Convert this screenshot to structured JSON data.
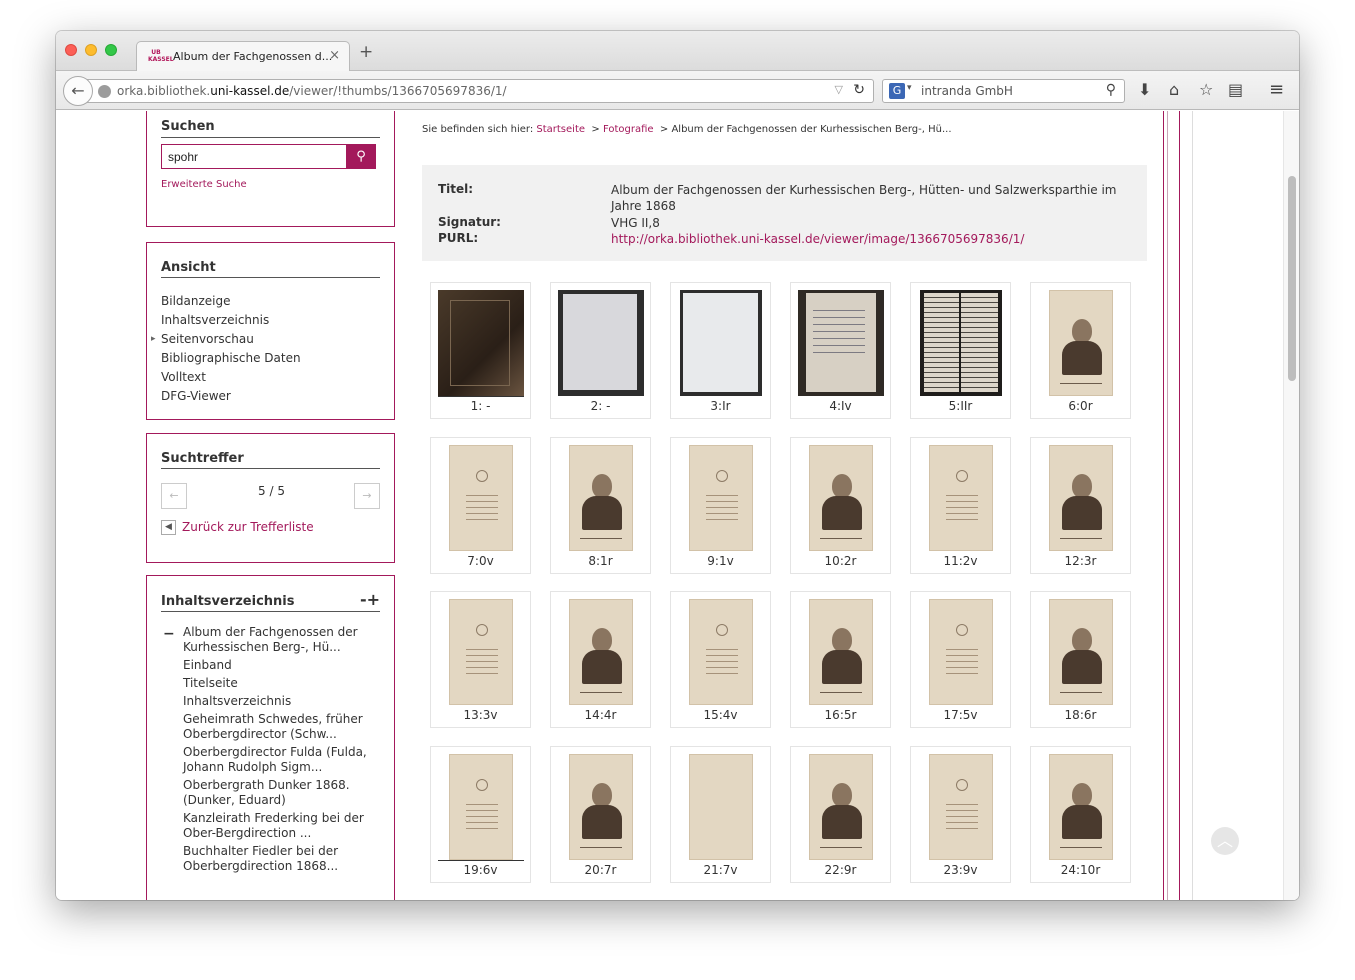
{
  "browser": {
    "tab_title": "Album der Fachgenossen d...",
    "favicon_text": "UB KASSEL",
    "tab_close": "×",
    "new_tab": "+",
    "url_prefix": "orka.bibliothek.",
    "url_domain": "uni-kassel.de",
    "url_path": "/viewer/!thumbs/1366705697836/1/",
    "search_engine": "intranda GmbH",
    "icons": [
      "back-arrow-icon",
      "globe-icon",
      "reload-icon",
      "search-engine-icon",
      "magnifier-icon",
      "download-icon",
      "home-icon",
      "star-icon",
      "reading-list-icon",
      "hamburger-menu-icon"
    ]
  },
  "sidebar": {
    "search": {
      "title": "Suchen",
      "query": "spohr",
      "advanced_link": "Erweiterte Suche"
    },
    "view": {
      "title": "Ansicht",
      "items": [
        "Bildanzeige",
        "Inhaltsverzeichnis",
        "Seitenvorschau",
        "Bibliographische Daten",
        "Volltext",
        "DFG-Viewer"
      ],
      "active_item": "Seitenvorschau"
    },
    "hits": {
      "title": "Suchtreffer",
      "count": "5 / 5",
      "back_link": "Zurück zur Trefferliste"
    },
    "toc": {
      "title": "Inhaltsverzeichnis",
      "tools": "-+",
      "collapse": "−",
      "items": [
        "Album der Fachgenossen der Kurhessischen Berg-, Hü...",
        "Einband",
        "Titelseite",
        "Inhaltsverzeichnis",
        "Geheimrath Schwedes, früher Oberbergdirector (Schw...",
        "Oberbergdirector Fulda (Fulda, Johann Rudolph Sigm...",
        "Oberbergrath Dunker 1868. (Dunker, Eduard)",
        "Kanzleirath Frederking bei der Ober-Bergdirection ...",
        "Buchhalter Fiedler bei der Oberbergdirection 1868..."
      ]
    }
  },
  "main": {
    "breadcrumb": {
      "prefix": "Sie befinden sich hier:",
      "home": "Startseite",
      "category": "Fotografie",
      "current": "Album der Fachgenossen der Kurhessischen Berg-, Hü..."
    },
    "metadata": {
      "title_label": "Titel:",
      "title_value": "Album der Fachgenossen der Kurhessischen Berg-, Hütten- und Salzwerksparthie im Jahre 1868",
      "signature_label": "Signatur:",
      "signature_value": "VHG II,8",
      "purl_label": "PURL:",
      "purl_value": "http://orka.bibliothek.uni-kassel.de/viewer/image/1366705697836/1/"
    },
    "thumbnails": [
      {
        "label": "1: -",
        "kind": "book"
      },
      {
        "label": "2: -",
        "kind": "cover"
      },
      {
        "label": "3:Ir",
        "kind": "blank"
      },
      {
        "label": "4:Iv",
        "kind": "text"
      },
      {
        "label": "5:IIr",
        "kind": "text-dense"
      },
      {
        "label": "6:0r",
        "kind": "portrait"
      },
      {
        "label": "7:0v",
        "kind": "card-back"
      },
      {
        "label": "8:1r",
        "kind": "portrait"
      },
      {
        "label": "9:1v",
        "kind": "card-back"
      },
      {
        "label": "10:2r",
        "kind": "portrait"
      },
      {
        "label": "11:2v",
        "kind": "card-back"
      },
      {
        "label": "12:3r",
        "kind": "portrait"
      },
      {
        "label": "13:3v",
        "kind": "card-back"
      },
      {
        "label": "14:4r",
        "kind": "portrait"
      },
      {
        "label": "15:4v",
        "kind": "card-back"
      },
      {
        "label": "16:5r",
        "kind": "portrait"
      },
      {
        "label": "17:5v",
        "kind": "card-back"
      },
      {
        "label": "18:6r",
        "kind": "portrait"
      },
      {
        "label": "19:6v",
        "kind": "card-back"
      },
      {
        "label": "20:7r",
        "kind": "portrait"
      },
      {
        "label": "21:7v",
        "kind": "card-blank"
      },
      {
        "label": "22:9r",
        "kind": "portrait"
      },
      {
        "label": "23:9v",
        "kind": "card-back"
      },
      {
        "label": "24:10r",
        "kind": "portrait"
      }
    ]
  },
  "colors": {
    "accent": "#a3195b",
    "meta_bg": "#f1f1f1"
  }
}
